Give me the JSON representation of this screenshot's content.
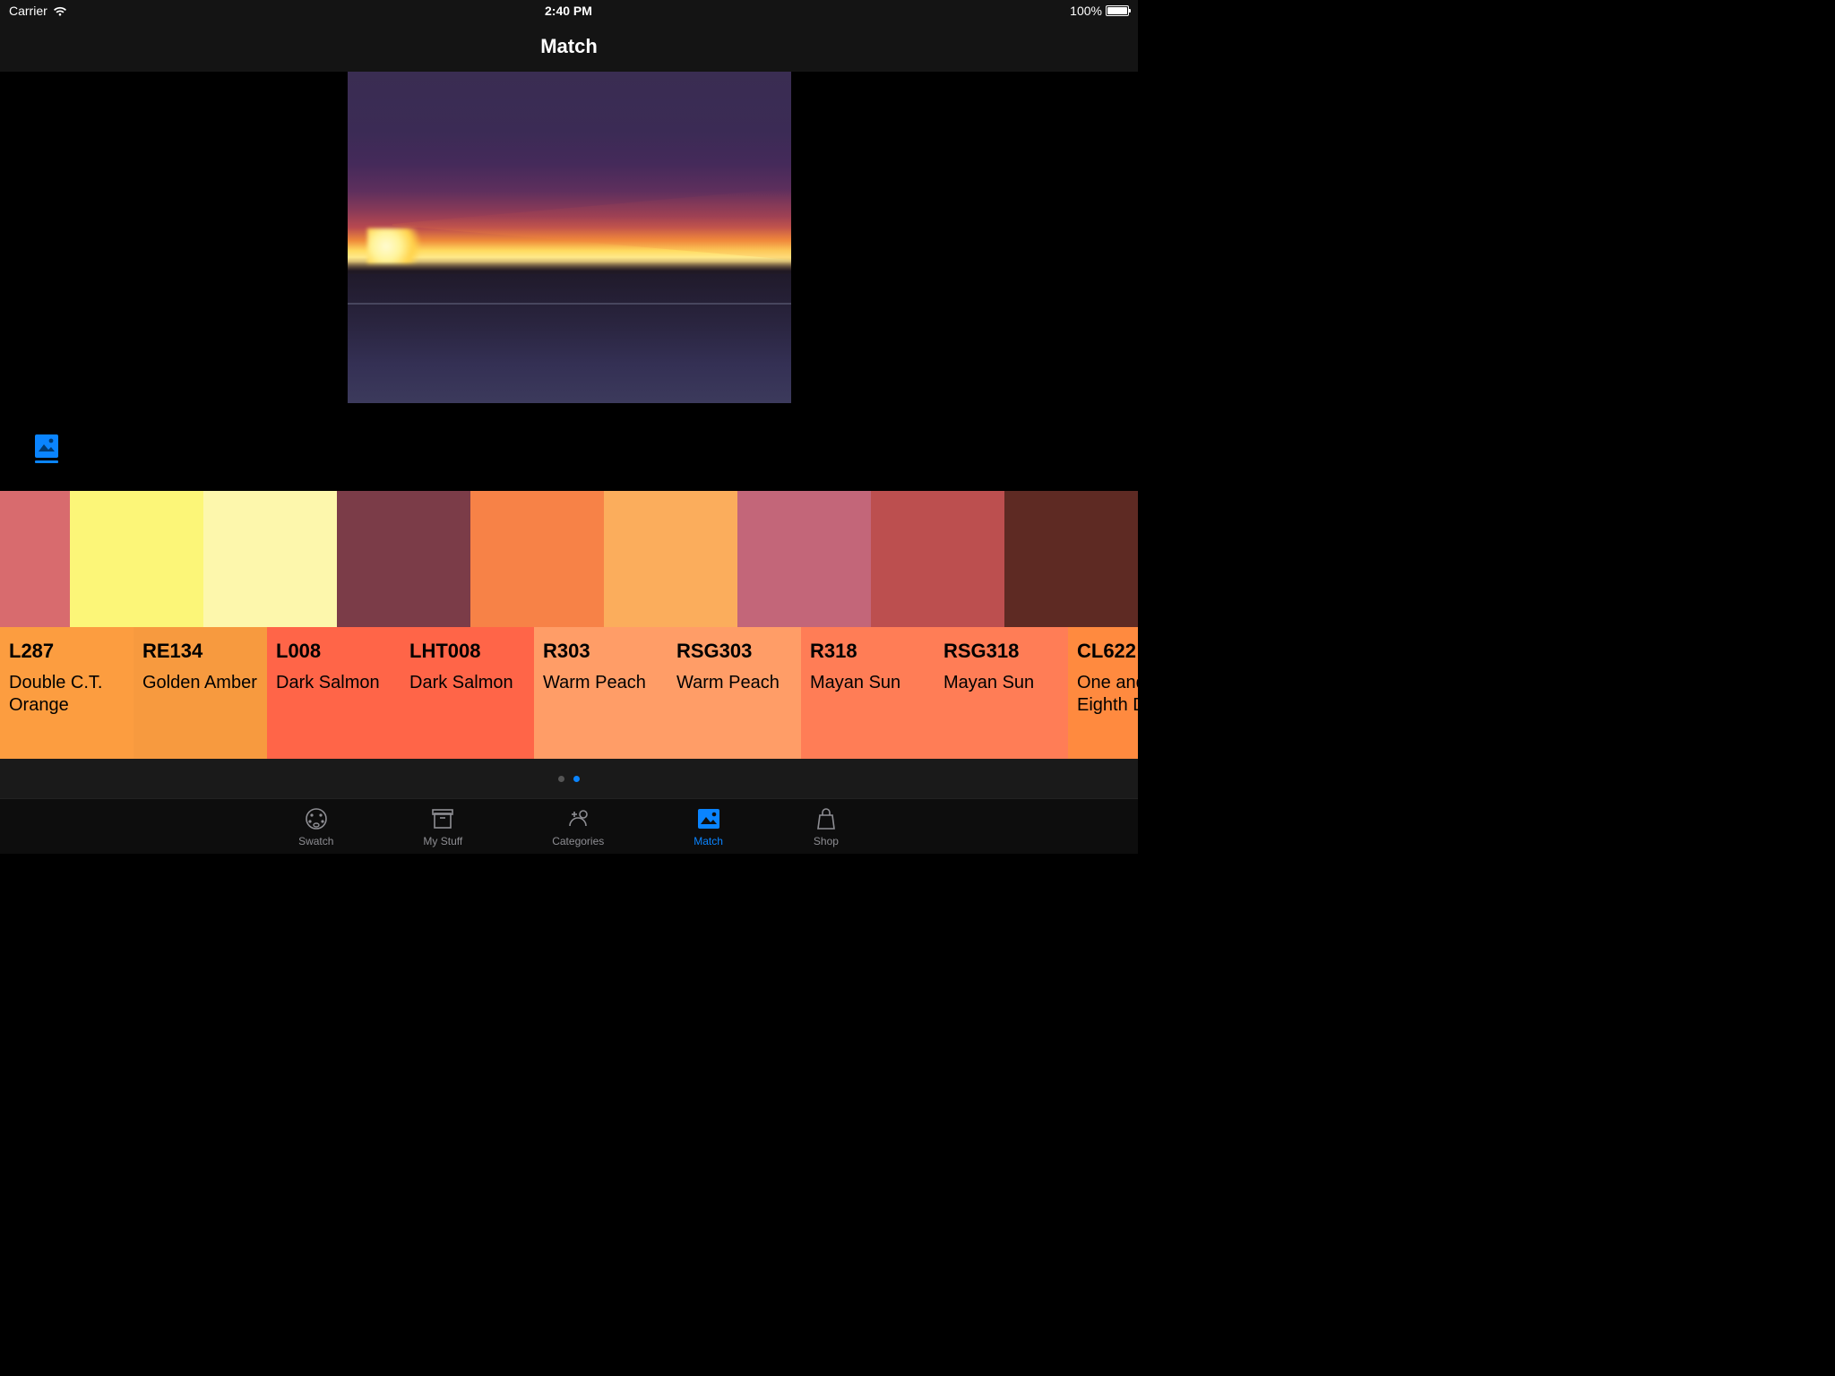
{
  "status": {
    "carrier": "Carrier",
    "time": "2:40 PM",
    "battery": "100%"
  },
  "nav": {
    "title": "Match"
  },
  "swatches": [
    {
      "color": "#d86b6e"
    },
    {
      "color": "#fcf678"
    },
    {
      "color": "#fdf7ac"
    },
    {
      "color": "#7b3c48"
    },
    {
      "color": "#f78247"
    },
    {
      "color": "#fbad5c"
    },
    {
      "color": "#c36679"
    },
    {
      "color": "#bc4f4f"
    },
    {
      "color": "#5e2a23"
    }
  ],
  "labels": [
    {
      "code": "L287",
      "name": "Double C.T. Orange",
      "bg": "#fc9d40"
    },
    {
      "code": "RE134",
      "name": "Golden Amber",
      "bg": "#f79a3f"
    },
    {
      "code": "L008",
      "name": "Dark Salmon",
      "bg": "#ff6548"
    },
    {
      "code": "LHT008",
      "name": "Dark Salmon",
      "bg": "#ff6548"
    },
    {
      "code": "R303",
      "name": "Warm Peach",
      "bg": "#ff9d67"
    },
    {
      "code": "RSG303",
      "name": "Warm Peach",
      "bg": "#ff9d67"
    },
    {
      "code": "R318",
      "name": "Mayan Sun",
      "bg": "#ff7d56"
    },
    {
      "code": "RSG318",
      "name": "Mayan Sun",
      "bg": "#ff7d56"
    },
    {
      "code": "CL622",
      "name": "One and One Eighth Digital",
      "bg": "#ff8a3f"
    }
  ],
  "pager": {
    "count": 2,
    "active": 1
  },
  "tabs": [
    {
      "id": "swatch",
      "label": "Swatch"
    },
    {
      "id": "mystuff",
      "label": "My Stuff"
    },
    {
      "id": "categories",
      "label": "Categories"
    },
    {
      "id": "match",
      "label": "Match"
    },
    {
      "id": "shop",
      "label": "Shop"
    }
  ],
  "active_tab": "match"
}
